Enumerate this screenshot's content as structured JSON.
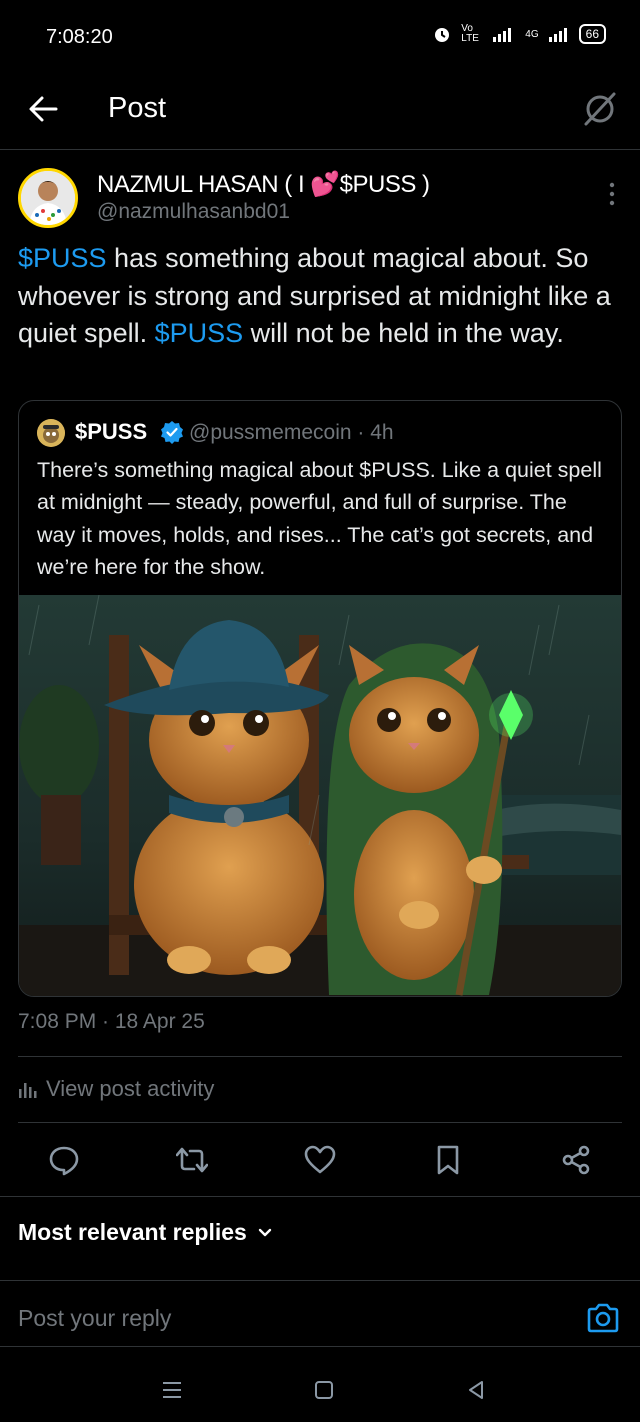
{
  "status_bar": {
    "time": "7:08:20",
    "network_label": "Vo LTE",
    "signal_label": "4G",
    "battery": "66"
  },
  "header": {
    "title": "Post"
  },
  "post": {
    "author_name": "NAZMUL HASAN ( I 💕$PUSS )",
    "author_handle": "@nazmulhasanbd01",
    "text_parts": [
      {
        "text": "$PUSS",
        "cashtag": true
      },
      {
        "text": " has something about magical about. So whoever is strong and surprised at midnight like a quiet spell. ",
        "cashtag": false
      },
      {
        "text": "$PUSS",
        "cashtag": true
      },
      {
        "text": " will not be held in the way.",
        "cashtag": false
      }
    ],
    "timestamp": "7:08 PM · 18 Apr 25",
    "activity_label": "View post activity"
  },
  "quote": {
    "name": "$PUSS",
    "handle_time": "@pussmemecoin · 4h",
    "text": "There’s something magical about $PUSS. Like a quiet spell at midnight — steady, powerful, and full of surprise. The way it moves, holds, and rises... The cat’s got secrets, and we’re here for the show.",
    "image_desc_icon": "two-cats-wizard-image"
  },
  "actions": [
    "reply-icon",
    "repost-icon",
    "like-icon",
    "bookmark-icon",
    "share-icon"
  ],
  "replies": {
    "sort_label": "Most relevant replies",
    "input_placeholder": "Post your reply"
  },
  "colors": {
    "background": "#000000",
    "accent": "#1d9bf0",
    "secondary_text": "#71767b",
    "divider": "#2f3336",
    "verified": "#1d9bf0"
  }
}
